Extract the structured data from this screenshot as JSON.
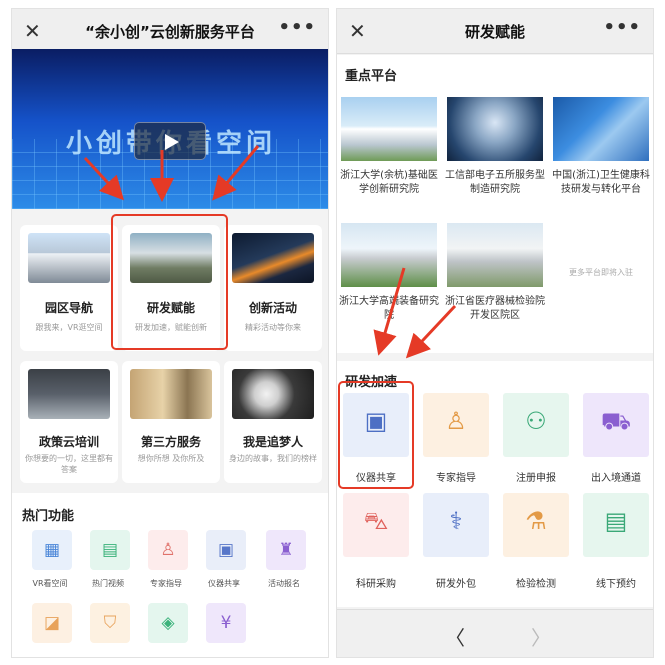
{
  "left": {
    "title": "“余小创”云创新服务平台",
    "close": "✕",
    "more": "•••",
    "hero_text": "小创带你看空间",
    "cards": [
      {
        "title": "园区导航",
        "sub": "跟我来，VR逛空间"
      },
      {
        "title": "研发赋能",
        "sub": "研发加速，赋能创新"
      },
      {
        "title": "创新活动",
        "sub": "精彩活动等你来"
      },
      {
        "title": "政策云培训",
        "sub": "你想要的一切，这里都有答案"
      },
      {
        "title": "第三方服务",
        "sub": "想你所想 及你所及"
      },
      {
        "title": "我是追梦人",
        "sub": "身边的故事，我们的榜样"
      }
    ],
    "hot_title": "热门功能",
    "hot_items": [
      "VR看空间",
      "热门视频",
      "专家指导",
      "仪器共享",
      "活动报名"
    ]
  },
  "right": {
    "title": "研发赋能",
    "close": "✕",
    "more": "•••",
    "platform_section": "重点平台",
    "platforms": [
      "浙江大学(余杭)基础医学创新研究院",
      "工信部电子五所服务型制造研究院",
      "中国(浙江)卫生健康科技研发与转化平台",
      "浙江大学高端装备研究院",
      "浙江省医疗器械检验院开发区院区"
    ],
    "more_note": "更多平台即将入驻",
    "accel_section": "研发加速",
    "services": [
      "仪器共享",
      "专家指导",
      "注册申报",
      "出入境通道",
      "科研采购",
      "研发外包",
      "检验检测",
      "线下预约"
    ],
    "prev": "〈",
    "next": "〉"
  },
  "colors": {
    "accent_red": "#e53a26",
    "hero_blue": "#1552c9"
  }
}
